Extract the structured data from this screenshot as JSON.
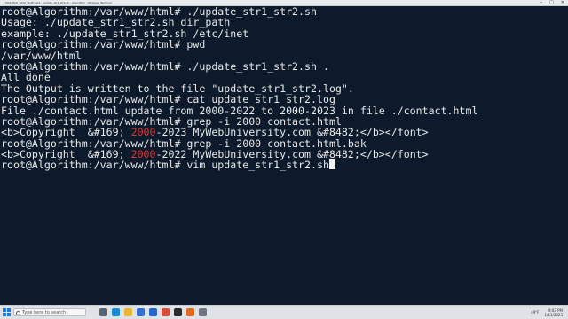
{
  "window": {
    "title": "Mod4Ep6_2022_Stuff.mp4 - update_str1_str2.sh - Algorithm - Windows Terminal",
    "controls": [
      "–",
      "□",
      "✕"
    ]
  },
  "terminal": {
    "lines": [
      {
        "text": "root@Algorithm:/var/www/html# ./update_str1_str2.sh"
      },
      {
        "text": "Usage: ./update_str1_str2.sh dir_path"
      },
      {
        "text": "example: ./update_str1_str2.sh /etc/inet"
      },
      {
        "text": "root@Algorithm:/var/www/html# pwd"
      },
      {
        "text": "/var/www/html"
      },
      {
        "text": "root@Algorithm:/var/www/html# ./update_str1_str2.sh ."
      },
      {
        "text": "All done"
      },
      {
        "text": "The Output is written to the file \"update_str1_str2.log\"."
      },
      {
        "text": "root@Algorithm:/var/www/html# cat update_str1_str2.log"
      },
      {
        "text": "File ./contact.html update from 2000-2022 to 2000-2023 in file ./contact.html"
      },
      {
        "text": "root@Algorithm:/var/www/html# grep -i 2000 contact.html"
      },
      {
        "pre": "<b>Copyright  &#169; ",
        "highlight": "2000",
        "post": "-2023 MyWebUniversity.com &#8482;</b></font>"
      },
      {
        "text": "root@Algorithm:/var/www/html# grep -i 2000 contact.html.bak"
      },
      {
        "pre": "<b>Copyright  &#169; ",
        "highlight": "2000",
        "post": "-2022 MyWebUniversity.com &#8482;</b></font>"
      },
      {
        "text": "root@Algorithm:/var/www/html# vim update_str1_str2.sh",
        "cursor": true
      }
    ]
  },
  "taskbar": {
    "search_placeholder": "Type here to search",
    "apps": [
      {
        "icon": "task-view-icon",
        "color": "#5a6570"
      },
      {
        "icon": "edge-icon",
        "color": "#1c8bd6"
      },
      {
        "icon": "file-explorer-icon",
        "color": "#e8b632"
      },
      {
        "icon": "store-icon",
        "color": "#3b6fd8"
      },
      {
        "icon": "mail-icon",
        "color": "#2a64c9"
      },
      {
        "icon": "chrome-icon",
        "color": "#d84a3a"
      },
      {
        "icon": "terminal-icon",
        "color": "#2b2b2b"
      },
      {
        "icon": "media-player-icon",
        "color": "#e46a1e"
      },
      {
        "icon": "settings-icon",
        "color": "#6d7680"
      }
    ],
    "weather": "49°F",
    "time": "9:02 PM",
    "date": "1/11/2023"
  }
}
